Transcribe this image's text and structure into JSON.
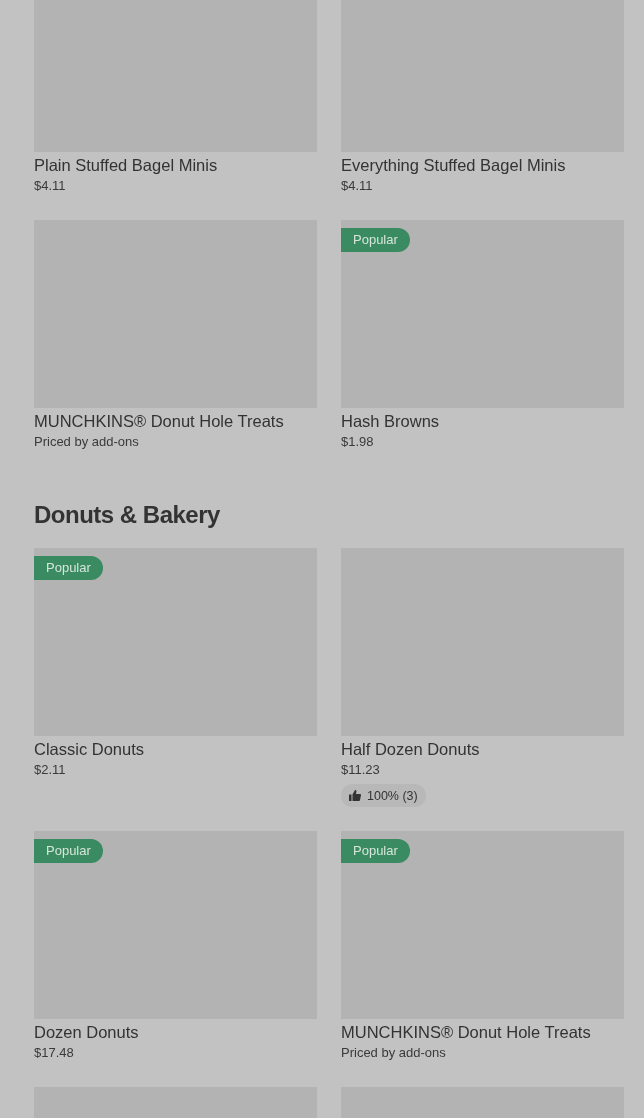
{
  "sections": [
    {
      "rows": [
        {
          "items": [
            {
              "kind": "product",
              "name": "Plain Stuffed Bagel Minis",
              "price": "$4.11"
            },
            {
              "kind": "product",
              "name": "Everything Stuffed Bagel Minis",
              "price": "$4.11"
            }
          ]
        },
        {
          "items": [
            {
              "kind": "product",
              "name": "MUNCHKINS® Donut Hole Treats",
              "price": "Priced by add-ons"
            },
            {
              "kind": "product",
              "name": "Hash Browns",
              "price": "$1.98",
              "badge": "Popular"
            }
          ]
        }
      ]
    },
    {
      "title": "Donuts & Bakery",
      "rows": [
        {
          "items": [
            {
              "kind": "product",
              "name": "Classic Donuts",
              "price": "$2.11",
              "badge": "Popular"
            },
            {
              "kind": "product",
              "name": "Half Dozen Donuts",
              "price": "$11.23",
              "rating": "100% (3)"
            }
          ]
        },
        {
          "items": [
            {
              "kind": "product",
              "name": "Dozen Donuts",
              "price": "$17.48",
              "badge": "Popular"
            },
            {
              "kind": "product",
              "name": "MUNCHKINS® Donut Hole Treats",
              "price": "Priced by add-ons",
              "badge": "Popular"
            }
          ]
        },
        {
          "items": [
            {
              "kind": "image-only"
            },
            {
              "kind": "image-only"
            }
          ]
        }
      ]
    }
  ]
}
